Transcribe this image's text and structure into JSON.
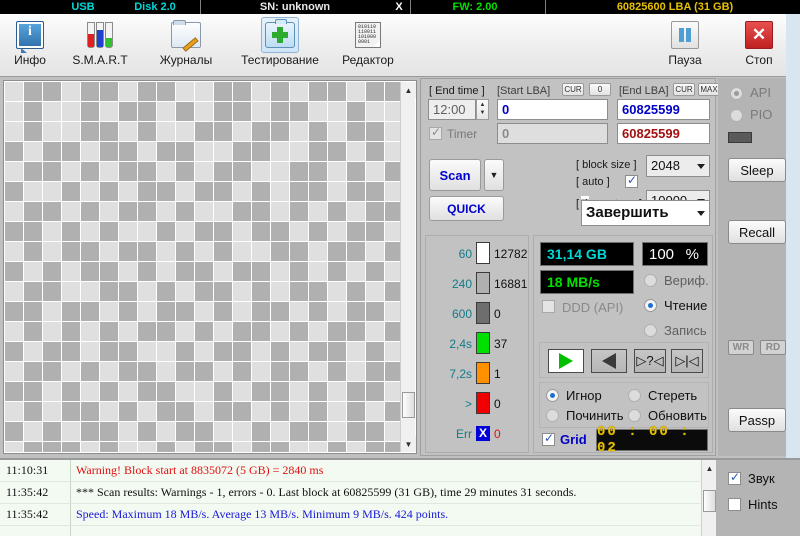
{
  "statusbar": {
    "bus": "USB",
    "disk": "Disk 2.0",
    "serial": "SN: unknown",
    "x_mark": "X",
    "firmware": "FW: 2.00",
    "capacity": "60825600 LBA (31 GB)"
  },
  "toolbar": {
    "items": [
      {
        "label": "Инфо",
        "icon": "info-icon"
      },
      {
        "label": "S.M.A.R.T",
        "icon": "test-tubes-icon"
      },
      {
        "label": "Журналы",
        "icon": "folder-pencil-icon"
      },
      {
        "label": "Тестирование",
        "icon": "first-aid-kit-icon"
      },
      {
        "label": "Редактор",
        "icon": "hex-editor-icon"
      }
    ],
    "pause_label": "Пауза",
    "stop_label": "Стоп",
    "editor_bits": "010110 110011 101000 0001"
  },
  "controls": {
    "end_time_label": "[ End time ]",
    "end_time_value": "12:00",
    "timer_label": "Timer",
    "timer_checked": true,
    "start_lba_label": "[Start LBA]",
    "start_lba_cur": "CUR",
    "start_lba_zero": "0",
    "start_lba_value": "0",
    "start_lba_value2": "0",
    "end_lba_label": "[End LBA]",
    "end_lba_cur": "CUR",
    "end_lba_max": "MAX",
    "end_lba_value": "60825599",
    "end_lba_value2": "60825599",
    "scan_label": "Scan",
    "quick_label": "QUICK",
    "block_size_label": "[ block size ]",
    "block_size_value": "2048",
    "auto_label": "[ auto ]",
    "auto_checked": true,
    "timeout_label": "[ timeout,ms ]",
    "timeout_value": "10000",
    "finish_action": "Завершить"
  },
  "stats": {
    "rows": [
      {
        "label": "60",
        "color": "#ffffff",
        "value": "12782"
      },
      {
        "label": "240",
        "color": "#b0b0b0",
        "value": "16881"
      },
      {
        "label": "600",
        "color": "#6e6e6e",
        "value": "0"
      },
      {
        "label": "2,4s",
        "color": "#00e000",
        "value": "37"
      },
      {
        "label": "7,2s",
        "color": "#ff9000",
        "value": "1"
      },
      {
        "label": ">",
        "color": "#f00000",
        "value": "0"
      },
      {
        "label": "Err",
        "color": "#0000d8",
        "value": "0"
      }
    ],
    "err_glyph": "X"
  },
  "readout": {
    "size": "31,14 GB",
    "size_color": "#00d8d8",
    "percent": "100",
    "percent_unit": "%",
    "speed": "18 MB/s",
    "speed_color": "#00e000",
    "ddd_label": "DDD (API)",
    "ddd_checked": false,
    "modes": [
      {
        "label": "Вериф.",
        "selected": false
      },
      {
        "label": "Чтение",
        "selected": true
      },
      {
        "label": "Запись",
        "selected": false
      }
    ],
    "transport": [
      {
        "name": "play-forward-button",
        "glyph": "▷"
      },
      {
        "name": "play-reverse-button",
        "glyph": "◁"
      },
      {
        "name": "seek-unknown-button",
        "glyph": "?"
      },
      {
        "name": "seek-end-button",
        "glyph": "|"
      }
    ],
    "actions": [
      {
        "label": "Игнор",
        "selected": true
      },
      {
        "label": "Стереть",
        "selected": false
      },
      {
        "label": "Починить",
        "selected": false
      },
      {
        "label": "Обновить",
        "selected": false
      }
    ],
    "grid_label": "Grid",
    "grid_checked": true,
    "elapsed": "00 : 00 : 02"
  },
  "rightcol": {
    "api_label": "API",
    "api_selected": true,
    "pio_label": "PIO",
    "pio_selected": false,
    "sleep_label": "Sleep",
    "recall_label": "Recall",
    "wr_label": "WR",
    "rd_label": "RD",
    "passp_label": "Passp"
  },
  "log": {
    "entries": [
      {
        "time": "11:10:31",
        "text": "Warning! Block start at 8835072 (5 GB)  = 2840 ms",
        "color": "#e01010"
      },
      {
        "time": "11:35:42",
        "text": "*** Scan results: Warnings - 1, errors - 0. Last block at 60825599 (31 GB), time 29 minutes 31 seconds.",
        "color": "#101010"
      },
      {
        "time": "11:35:42",
        "text": "Speed: Maximum 18 MB/s. Average 13 MB/s. Minimum 9 MB/s. 424 points.",
        "color": "#1818d8"
      }
    ]
  },
  "bottomright": {
    "sound_label": "Звук",
    "sound_checked": true,
    "hints_label": "Hints",
    "hints_checked": false
  },
  "blockmap": {
    "cols": 21,
    "rows": 19,
    "light": "#dfdfdf",
    "dark": "#b0b0b0",
    "pattern": [
      "011011011001101011011",
      "010010110101101100100",
      "010011010011011010110",
      "101101101100110011010",
      "011010110101100110101",
      "100101011011010110110",
      "011010110100110101011",
      "110101001011011010110",
      "010110110101001101101",
      "101011010110110101010",
      "011001101011010110101",
      "110110101101011010110",
      "010101011010110101101",
      "101101100101101011010",
      "011010110110101101011",
      "110101011001011010110",
      "010110101101101010101",
      "101011010110010110110",
      "011101001011011001011"
    ]
  }
}
